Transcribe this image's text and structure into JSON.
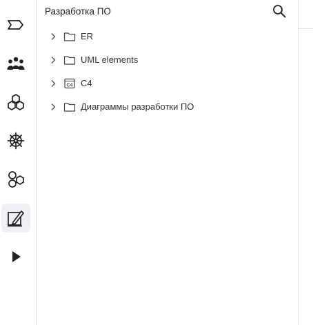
{
  "rail": {
    "items": [
      {
        "icon": "tag-icon",
        "active": false
      },
      {
        "icon": "users-icon",
        "active": false
      },
      {
        "icon": "hexagon-cluster-icon",
        "active": false
      },
      {
        "icon": "ship-wheel-icon",
        "active": false
      },
      {
        "icon": "shapes-icon",
        "active": false
      },
      {
        "icon": "design-pen-icon",
        "active": true
      },
      {
        "icon": "play-icon",
        "active": false
      }
    ]
  },
  "panel": {
    "title": "Разработка ПО",
    "search_icon": "search-icon",
    "tree": [
      {
        "label": "ER",
        "icon": "folder-icon"
      },
      {
        "label": "UML elements",
        "icon": "folder-icon"
      },
      {
        "label": "C4",
        "icon": "c4-icon",
        "icon_text": "C4"
      },
      {
        "label": "Диаграммы разработки ПО",
        "icon": "folder-icon"
      }
    ]
  },
  "colors": {
    "border": "#e4e4e4",
    "active_bg": "#eef0f5",
    "icon": "#222222"
  }
}
